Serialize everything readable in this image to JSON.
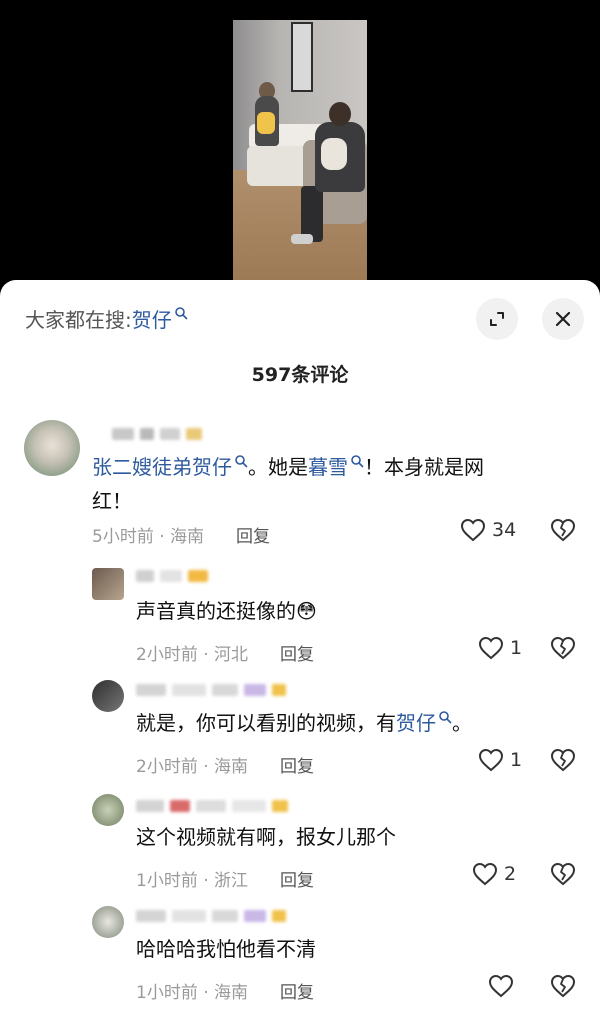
{
  "header": {
    "search_prefix": "大家都在搜:",
    "search_keyword": "贺仔"
  },
  "comment_count_label": "597条评论",
  "comments": [
    {
      "text_kw1": "张二嫂徒弟贺仔",
      "text_mid": "。她是",
      "text_kw2": "暮雪",
      "text_end": "！本身就是网",
      "text_line2": "红！",
      "time_location": "5小时前 · 海南",
      "reply_label": "回复",
      "like_count": "34"
    },
    {
      "text": "声音真的还挺像的😳",
      "time_location": "2小时前 · 河北",
      "reply_label": "回复",
      "like_count": "1"
    },
    {
      "text_pre": "就是，你可以看别的视频，有",
      "text_kw": "贺仔",
      "text_post": "。",
      "time_location": "2小时前 · 海南",
      "reply_label": "回复",
      "like_count": "1"
    },
    {
      "text": "这个视频就有啊，报女儿那个",
      "time_location": "1小时前 · 浙江",
      "reply_label": "回复",
      "like_count": "2"
    },
    {
      "text": "哈哈哈我怕他看不清",
      "time_location": "1小时前 · 海南",
      "reply_label": "回复",
      "like_count": ""
    }
  ],
  "colors": {
    "keyword_blue": "#2e5a9e",
    "meta_gray": "#9a9a9a"
  }
}
